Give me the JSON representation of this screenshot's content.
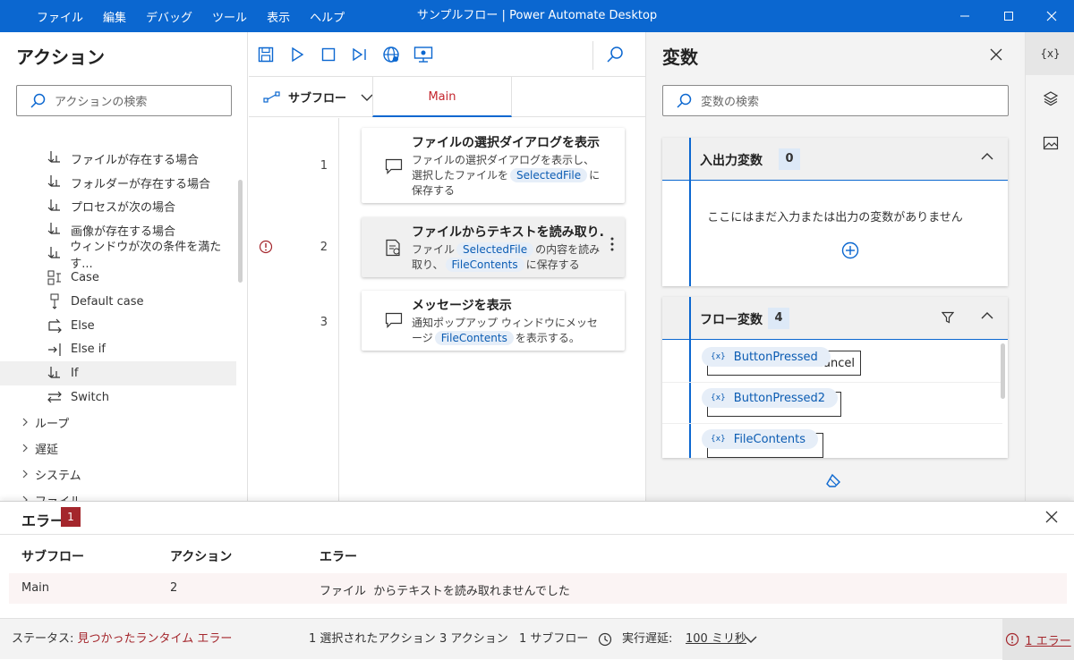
{
  "titlebar": {
    "menu": [
      "ファイル",
      "編集",
      "デバッグ",
      "ツール",
      "表示",
      "ヘルプ"
    ],
    "title": "サンプルフロー | Power Automate Desktop"
  },
  "actions_panel": {
    "title": "アクション",
    "search_placeholder": "アクションの検索",
    "items": [
      {
        "label": "ファイルが存在する場合",
        "icon": "if-branch-icon"
      },
      {
        "label": "フォルダーが存在する場合",
        "icon": "if-branch-icon"
      },
      {
        "label": "プロセスが次の場合",
        "icon": "if-branch-icon"
      },
      {
        "label": "画像が存在する場合",
        "icon": "if-branch-icon"
      },
      {
        "label": "ウィンドウが次の条件を満たす...",
        "icon": "if-branch-icon"
      },
      {
        "label": "Case",
        "icon": "case-icon"
      },
      {
        "label": "Default case",
        "icon": "default-case-icon"
      },
      {
        "label": "Else",
        "icon": "else-icon"
      },
      {
        "label": "Else if",
        "icon": "else-if-icon"
      },
      {
        "label": "If",
        "icon": "if-branch-icon",
        "selected": true
      },
      {
        "label": "Switch",
        "icon": "switch-icon"
      }
    ],
    "groups": [
      "ループ",
      "遅延",
      "システム",
      "ファイル"
    ]
  },
  "designer": {
    "subflow_label": "サブフロー",
    "main_tab": "Main",
    "steps": [
      {
        "num": "1",
        "title": "ファイルの選択ダイアログを表示",
        "desc_a": "ファイルの選択ダイアログを表示し、選択したファイルを",
        "token_a": "SelectedFile",
        "desc_b": "に保存する",
        "token_b": "",
        "desc_c": ""
      },
      {
        "num": "2",
        "title": "ファイルからテキストを読み取り...",
        "desc_a": "ファイル",
        "token_a": "SelectedFile",
        "desc_b": "の内容を読み取り、",
        "token_b": "FileContents",
        "desc_c": "に保存する"
      },
      {
        "num": "3",
        "title": "メッセージを表示",
        "desc_a": "通知ポップアップ ウィンドウにメッセージ",
        "token_a": "FileContents",
        "desc_b": "を表示する。",
        "token_b": "",
        "desc_c": ""
      }
    ]
  },
  "variables_panel": {
    "title": "変数",
    "search_placeholder": "変数の検索",
    "io_section": {
      "label": "入出力変数",
      "count": "0",
      "empty_text": "ここにはまだ入力または出力の変数がありません"
    },
    "flow_section": {
      "label": "フロー変数",
      "count": "4",
      "variables": [
        {
          "name": "ButtonPressed",
          "value": "Cancel"
        },
        {
          "name": "ButtonPressed2",
          "value": ""
        },
        {
          "name": "FileContents",
          "value": ""
        }
      ]
    }
  },
  "error_pane": {
    "title": "エラー",
    "count": "1",
    "columns": [
      "サブフロー",
      "アクション",
      "エラー"
    ],
    "rows": [
      {
        "subflow": "Main",
        "action": "2",
        "error": "ファイル  からテキストを読み取れませんでした"
      }
    ]
  },
  "statusbar": {
    "status_label": "ステータス: ",
    "status_value": "見つかったランタイム エラー",
    "selected_actions": "1 選択されたアクション",
    "actions_count": "3 アクション",
    "subflows_count": "1 サブフロー",
    "delay_label": "実行遅延:",
    "delay_value": "100 ミリ秒",
    "errors_link": "1 エラー"
  },
  "colors": {
    "accent": "#0b67d0",
    "error": "#a4262c",
    "token_bg": "#e6eef8"
  }
}
